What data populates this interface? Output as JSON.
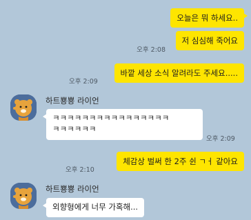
{
  "sender_name": "하트뿅뿅 라이언",
  "messages": [
    {
      "text": "오늘은 뭐 하세요.."
    },
    {
      "text": "저 심심해 죽어요",
      "time": "오후 2:08"
    },
    {
      "text": "바깥 세상 소식 알려라도 주세요.....",
      "time": "오후 2:09"
    },
    {
      "text_line1": "ㅋㅋㅋㅋㅋㅋㅋㅋㅋㅋㅋㅋㅋㅋㅋㅋ",
      "text_line2": "ㅋㅋㅋㅋㅋㅋ",
      "time": "오후 2:09"
    },
    {
      "text": "체감상 벌써 한 2주 쉰 ㄱㅓ 같아요",
      "time": "오후 2:10"
    },
    {
      "text": "외향형에게 너무 가혹해..."
    }
  ]
}
